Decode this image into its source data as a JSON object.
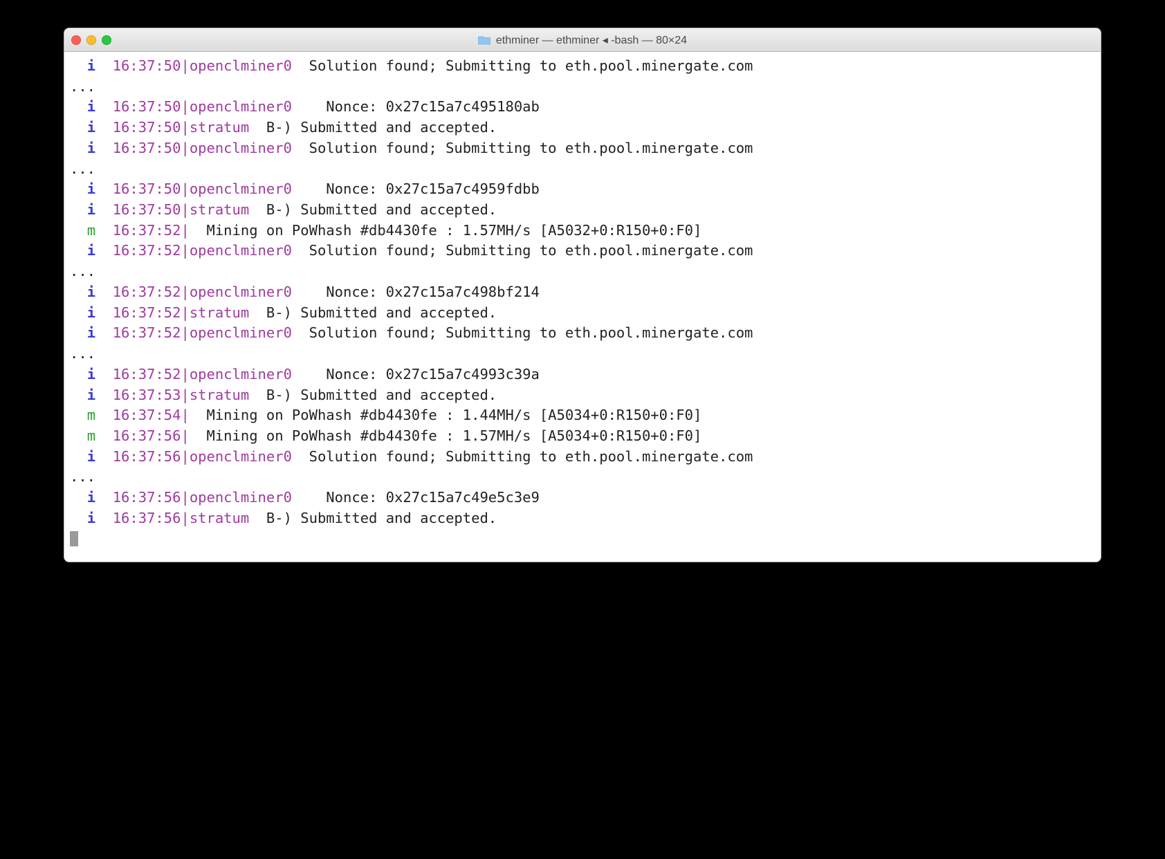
{
  "window": {
    "title": "ethminer — ethminer ◂ -bash — 80×24",
    "folder_name": "ethminer"
  },
  "lines": [
    {
      "level": "i",
      "levelClass": "lvl-i",
      "time": "16:37:50",
      "src": "openclminer0",
      "msg": " Solution found; Submitting to eth.pool.minergate.com"
    },
    {
      "raw": "..."
    },
    {
      "level": "i",
      "levelClass": "lvl-i",
      "time": "16:37:50",
      "src": "openclminer0",
      "msg": "   Nonce: 0x27c15a7c495180ab"
    },
    {
      "level": "i",
      "levelClass": "lvl-i",
      "time": "16:37:50",
      "src": "stratum",
      "msg": "B-) Submitted and accepted."
    },
    {
      "level": "i",
      "levelClass": "lvl-i",
      "time": "16:37:50",
      "src": "openclminer0",
      "msg": " Solution found; Submitting to eth.pool.minergate.com"
    },
    {
      "raw": "..."
    },
    {
      "level": "i",
      "levelClass": "lvl-i",
      "time": "16:37:50",
      "src": "openclminer0",
      "msg": "   Nonce: 0x27c15a7c4959fdbb"
    },
    {
      "level": "i",
      "levelClass": "lvl-i",
      "time": "16:37:50",
      "src": "stratum",
      "msg": "B-) Submitted and accepted."
    },
    {
      "level": "m",
      "levelClass": "lvl-m",
      "time": "16:37:52",
      "src": "",
      "msg": " Mining on PoWhash #db4430fe : 1.57MH/s [A5032+0:R150+0:F0]"
    },
    {
      "level": "i",
      "levelClass": "lvl-i",
      "time": "16:37:52",
      "src": "openclminer0",
      "msg": " Solution found; Submitting to eth.pool.minergate.com"
    },
    {
      "raw": "..."
    },
    {
      "level": "i",
      "levelClass": "lvl-i",
      "time": "16:37:52",
      "src": "openclminer0",
      "msg": "   Nonce: 0x27c15a7c498bf214"
    },
    {
      "level": "i",
      "levelClass": "lvl-i",
      "time": "16:37:52",
      "src": "stratum",
      "msg": "B-) Submitted and accepted."
    },
    {
      "level": "i",
      "levelClass": "lvl-i",
      "time": "16:37:52",
      "src": "openclminer0",
      "msg": " Solution found; Submitting to eth.pool.minergate.com"
    },
    {
      "raw": "..."
    },
    {
      "level": "i",
      "levelClass": "lvl-i",
      "time": "16:37:52",
      "src": "openclminer0",
      "msg": "   Nonce: 0x27c15a7c4993c39a"
    },
    {
      "level": "i",
      "levelClass": "lvl-i",
      "time": "16:37:53",
      "src": "stratum",
      "msg": "B-) Submitted and accepted."
    },
    {
      "level": "m",
      "levelClass": "lvl-m",
      "time": "16:37:54",
      "src": "",
      "msg": " Mining on PoWhash #db4430fe : 1.44MH/s [A5034+0:R150+0:F0]"
    },
    {
      "level": "m",
      "levelClass": "lvl-m",
      "time": "16:37:56",
      "src": "",
      "msg": " Mining on PoWhash #db4430fe : 1.57MH/s [A5034+0:R150+0:F0]"
    },
    {
      "level": "i",
      "levelClass": "lvl-i",
      "time": "16:37:56",
      "src": "openclminer0",
      "msg": " Solution found; Submitting to eth.pool.minergate.com"
    },
    {
      "raw": "..."
    },
    {
      "level": "i",
      "levelClass": "lvl-i",
      "time": "16:37:56",
      "src": "openclminer0",
      "msg": "   Nonce: 0x27c15a7c49e5c3e9"
    },
    {
      "level": "i",
      "levelClass": "lvl-i",
      "time": "16:37:56",
      "src": "stratum",
      "msg": "B-) Submitted and accepted."
    }
  ]
}
